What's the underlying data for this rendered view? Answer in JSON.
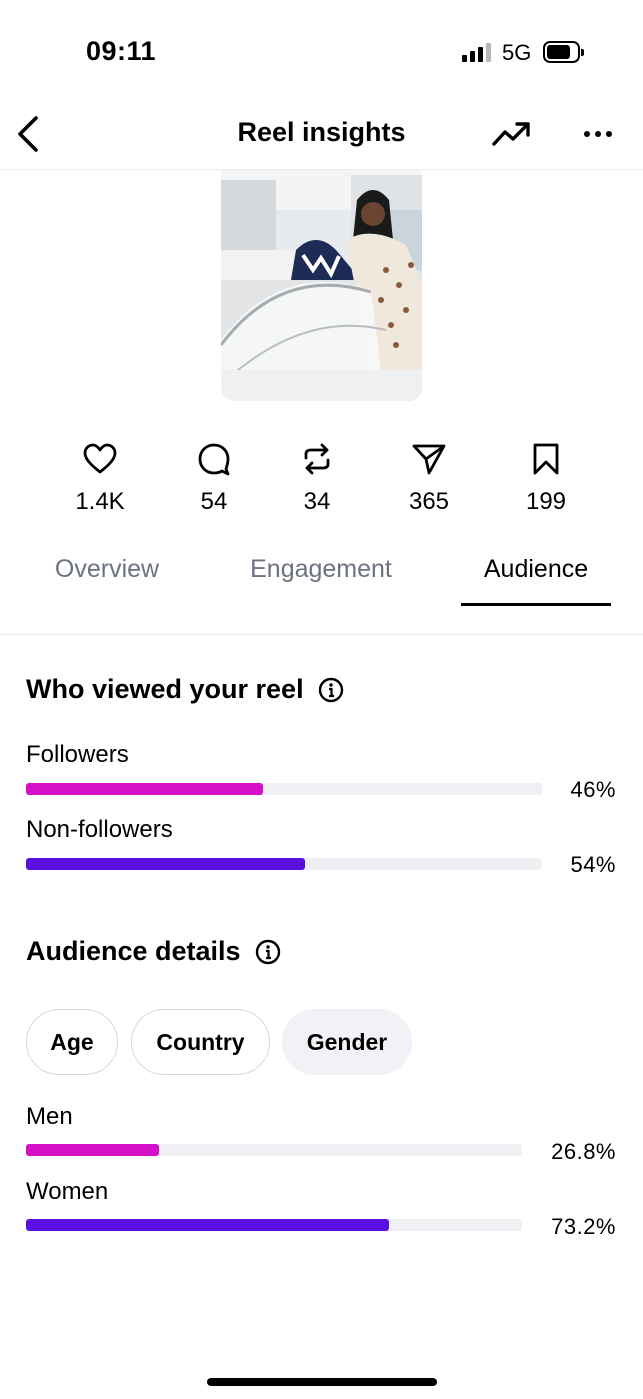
{
  "status_bar": {
    "time": "09:11",
    "network": "5G"
  },
  "nav": {
    "title": "Reel insights",
    "back_icon": "chevron-left-icon",
    "trend_icon": "trending-up-icon",
    "more_icon": "more-horizontal-icon"
  },
  "metrics": [
    {
      "icon": "heart-icon",
      "value": "1.4K"
    },
    {
      "icon": "comment-icon",
      "value": "54"
    },
    {
      "icon": "repost-icon",
      "value": "34"
    },
    {
      "icon": "share-icon",
      "value": "365"
    },
    {
      "icon": "bookmark-icon",
      "value": "199"
    }
  ],
  "tabs": {
    "overview": "Overview",
    "engagement": "Engagement",
    "audience": "Audience",
    "active": "Audience"
  },
  "viewers": {
    "title": "Who viewed your reel",
    "rows": [
      {
        "label": "Followers",
        "value": "46%",
        "fraction": 0.46,
        "color": "#d40fc7"
      },
      {
        "label": "Non-followers",
        "value": "54%",
        "fraction": 0.54,
        "color": "#5b10e3"
      }
    ]
  },
  "audience_details": {
    "title": "Audience details",
    "filters": [
      "Age",
      "Country",
      "Gender"
    ],
    "selected_filter": "Gender",
    "rows": [
      {
        "label": "Men",
        "value": "26.8%",
        "fraction": 0.268,
        "color": "#d40fc7"
      },
      {
        "label": "Women",
        "value": "73.2%",
        "fraction": 0.732,
        "color": "#5b10e3"
      }
    ]
  }
}
